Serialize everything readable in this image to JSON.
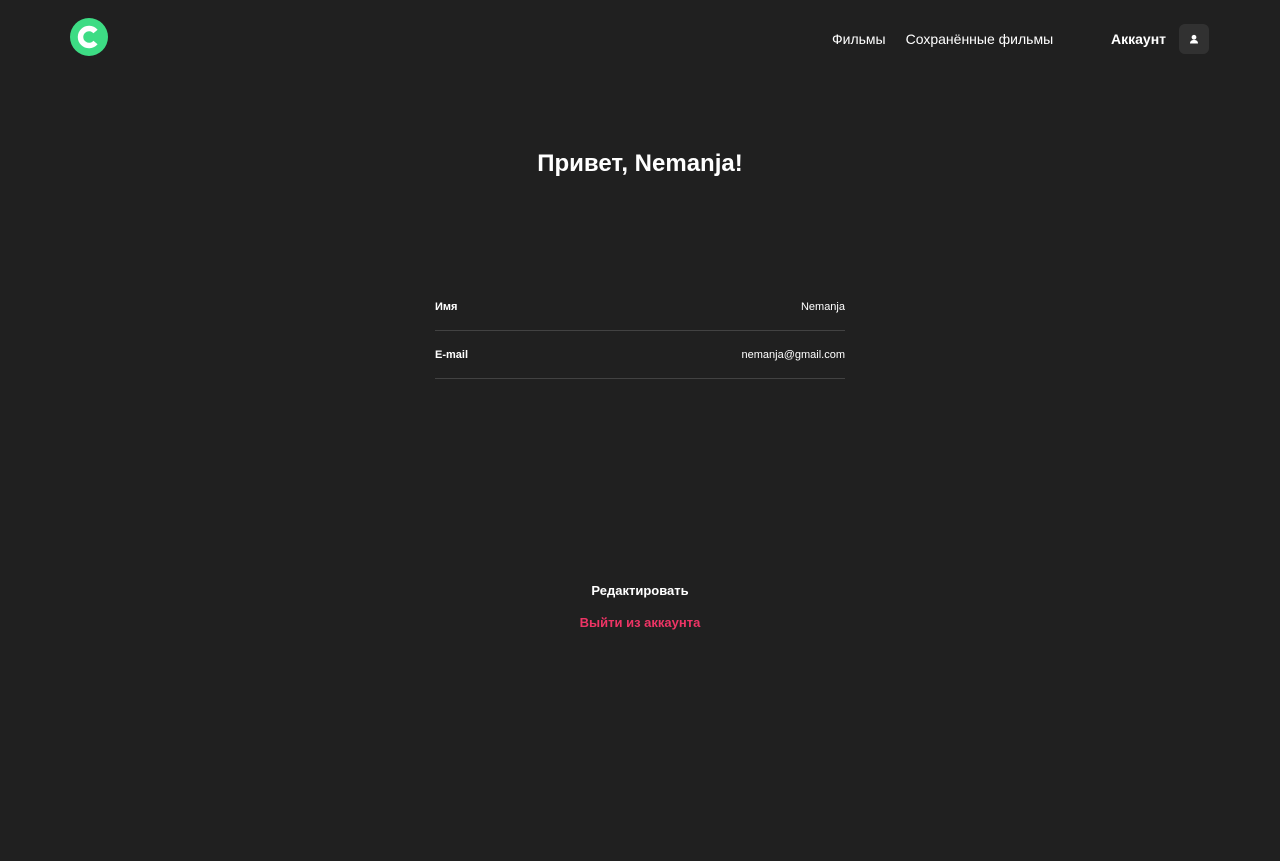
{
  "header": {
    "logo_icon": "logo-c-icon",
    "nav": [
      {
        "label": "Фильмы"
      },
      {
        "label": "Сохранённые фильмы"
      }
    ],
    "account_label": "Аккаунт",
    "account_icon": "user-icon"
  },
  "profile": {
    "greeting": "Привет, Nemanja!",
    "fields": [
      {
        "label": "Имя",
        "value": "Nemanja"
      },
      {
        "label": "E-mail",
        "value": "nemanja@gmail.com"
      }
    ],
    "edit_label": "Редактировать",
    "logout_label": "Выйти из аккаунта"
  },
  "colors": {
    "background": "#202020",
    "accent": "#3ddc84",
    "danger": "#ee3465"
  }
}
